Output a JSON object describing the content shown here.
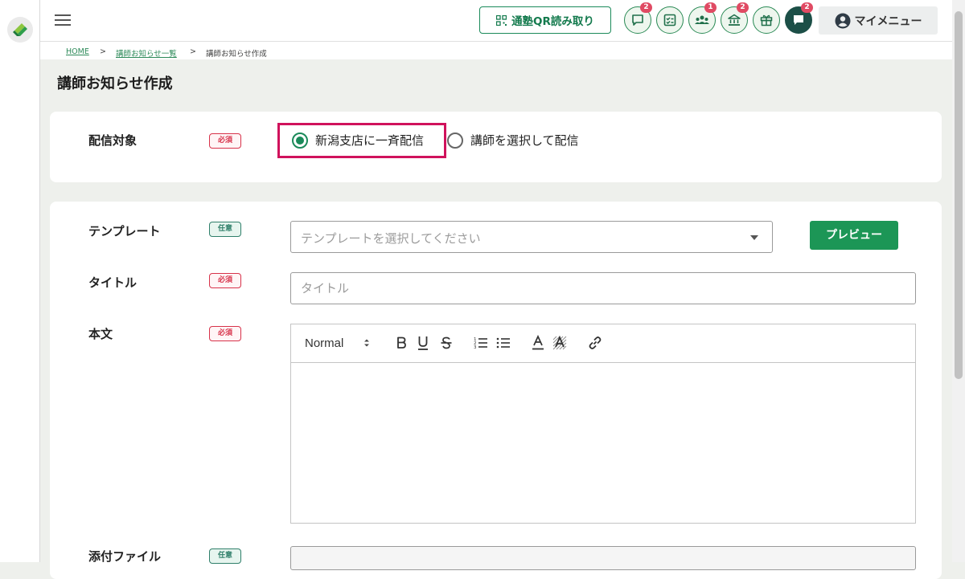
{
  "header": {
    "qr_label": "通塾QR読み取り",
    "icons": [
      {
        "name": "chat-bubble-icon",
        "badge": "2"
      },
      {
        "name": "checklist-icon",
        "badge": ""
      },
      {
        "name": "people-icon",
        "badge": "1"
      },
      {
        "name": "bank-icon",
        "badge": "2"
      },
      {
        "name": "gift-icon",
        "badge": ""
      },
      {
        "name": "message-icon",
        "badge": "2"
      }
    ],
    "my_menu_label": "マイメニュー",
    "accent_color": "#1b8a5a"
  },
  "breadcrumb": {
    "home": "HOME",
    "separator": ">",
    "list": "講師お知らせ一覧",
    "current": "講師お知らせ作成"
  },
  "page": {
    "title": "講師お知らせ作成"
  },
  "form": {
    "target": {
      "label": "配信対象",
      "tag": "必須",
      "options": [
        "新潟支店に一斉配信",
        "講師を選択して配信"
      ],
      "selected": "新潟支店に一斉配信"
    },
    "template": {
      "label": "テンプレート",
      "tag": "任意",
      "placeholder": "テンプレートを選択してください",
      "preview_button": "プレビュー"
    },
    "title_field": {
      "label": "タイトル",
      "tag": "必須",
      "placeholder": "タイトル"
    },
    "body": {
      "label": "本文",
      "tag": "必須",
      "format_select": "Normal",
      "tools": [
        "bold-icon",
        "underline-icon",
        "strikethrough-icon",
        "ordered-list-icon",
        "bullet-list-icon",
        "text-color-icon",
        "highlight-color-icon",
        "link-icon"
      ]
    },
    "attachment": {
      "label": "添付ファイル",
      "tag": "任意"
    }
  }
}
